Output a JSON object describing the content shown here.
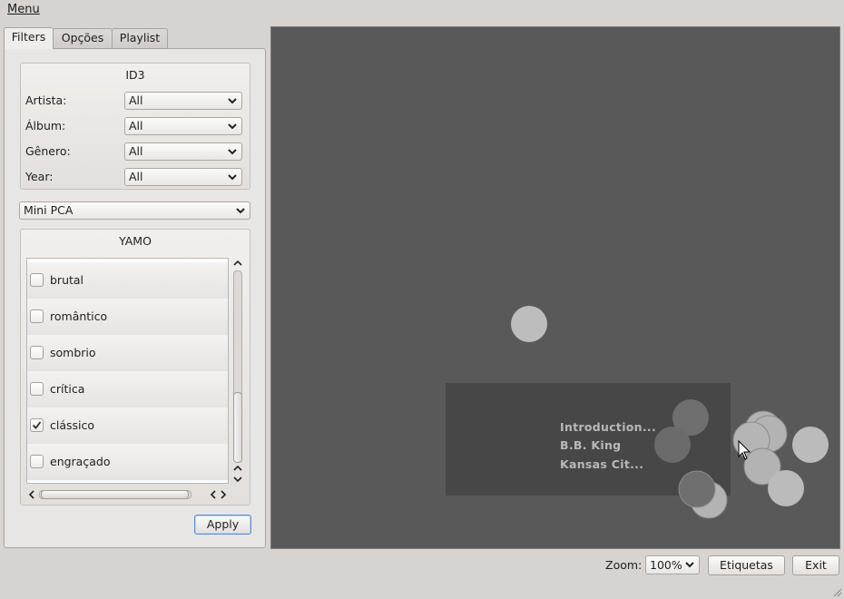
{
  "menubar": {
    "menu_label": "Menu"
  },
  "tabs": [
    {
      "label": "Filters",
      "active": true
    },
    {
      "label": "Opções",
      "active": false
    },
    {
      "label": "Playlist",
      "active": false
    }
  ],
  "id3": {
    "title": "ID3",
    "fields": [
      {
        "label": "Artista:",
        "value": "All"
      },
      {
        "label": "Álbum:",
        "value": "All"
      },
      {
        "label": "Gênero:",
        "value": "All"
      },
      {
        "label": "Year:",
        "value": "All"
      }
    ]
  },
  "mode_select": {
    "value": "Mini PCA"
  },
  "yamo": {
    "title": "YAMO",
    "items": [
      {
        "label": "brutal",
        "checked": false
      },
      {
        "label": "romântico",
        "checked": false
      },
      {
        "label": "sombrio",
        "checked": false
      },
      {
        "label": "crítica",
        "checked": false
      },
      {
        "label": "clássico",
        "checked": true
      },
      {
        "label": "engraçado",
        "checked": false
      }
    ]
  },
  "apply_button": {
    "label": "Apply"
  },
  "tooltip": {
    "lines": [
      "Introduction...",
      "B.B. King",
      "Kansas Cit..."
    ]
  },
  "bottom": {
    "zoom_label": "Zoom:",
    "zoom_value": "100%",
    "etiquetas_label": "Etiquetas",
    "exit_label": "Exit"
  },
  "colors": {
    "canvas_bg": "#595959",
    "dot_light": "#b9b9b9",
    "dot_dark": "#6e6e6e",
    "tooltip_bg": "#474747",
    "tooltip_text": "#b8b8b8"
  }
}
